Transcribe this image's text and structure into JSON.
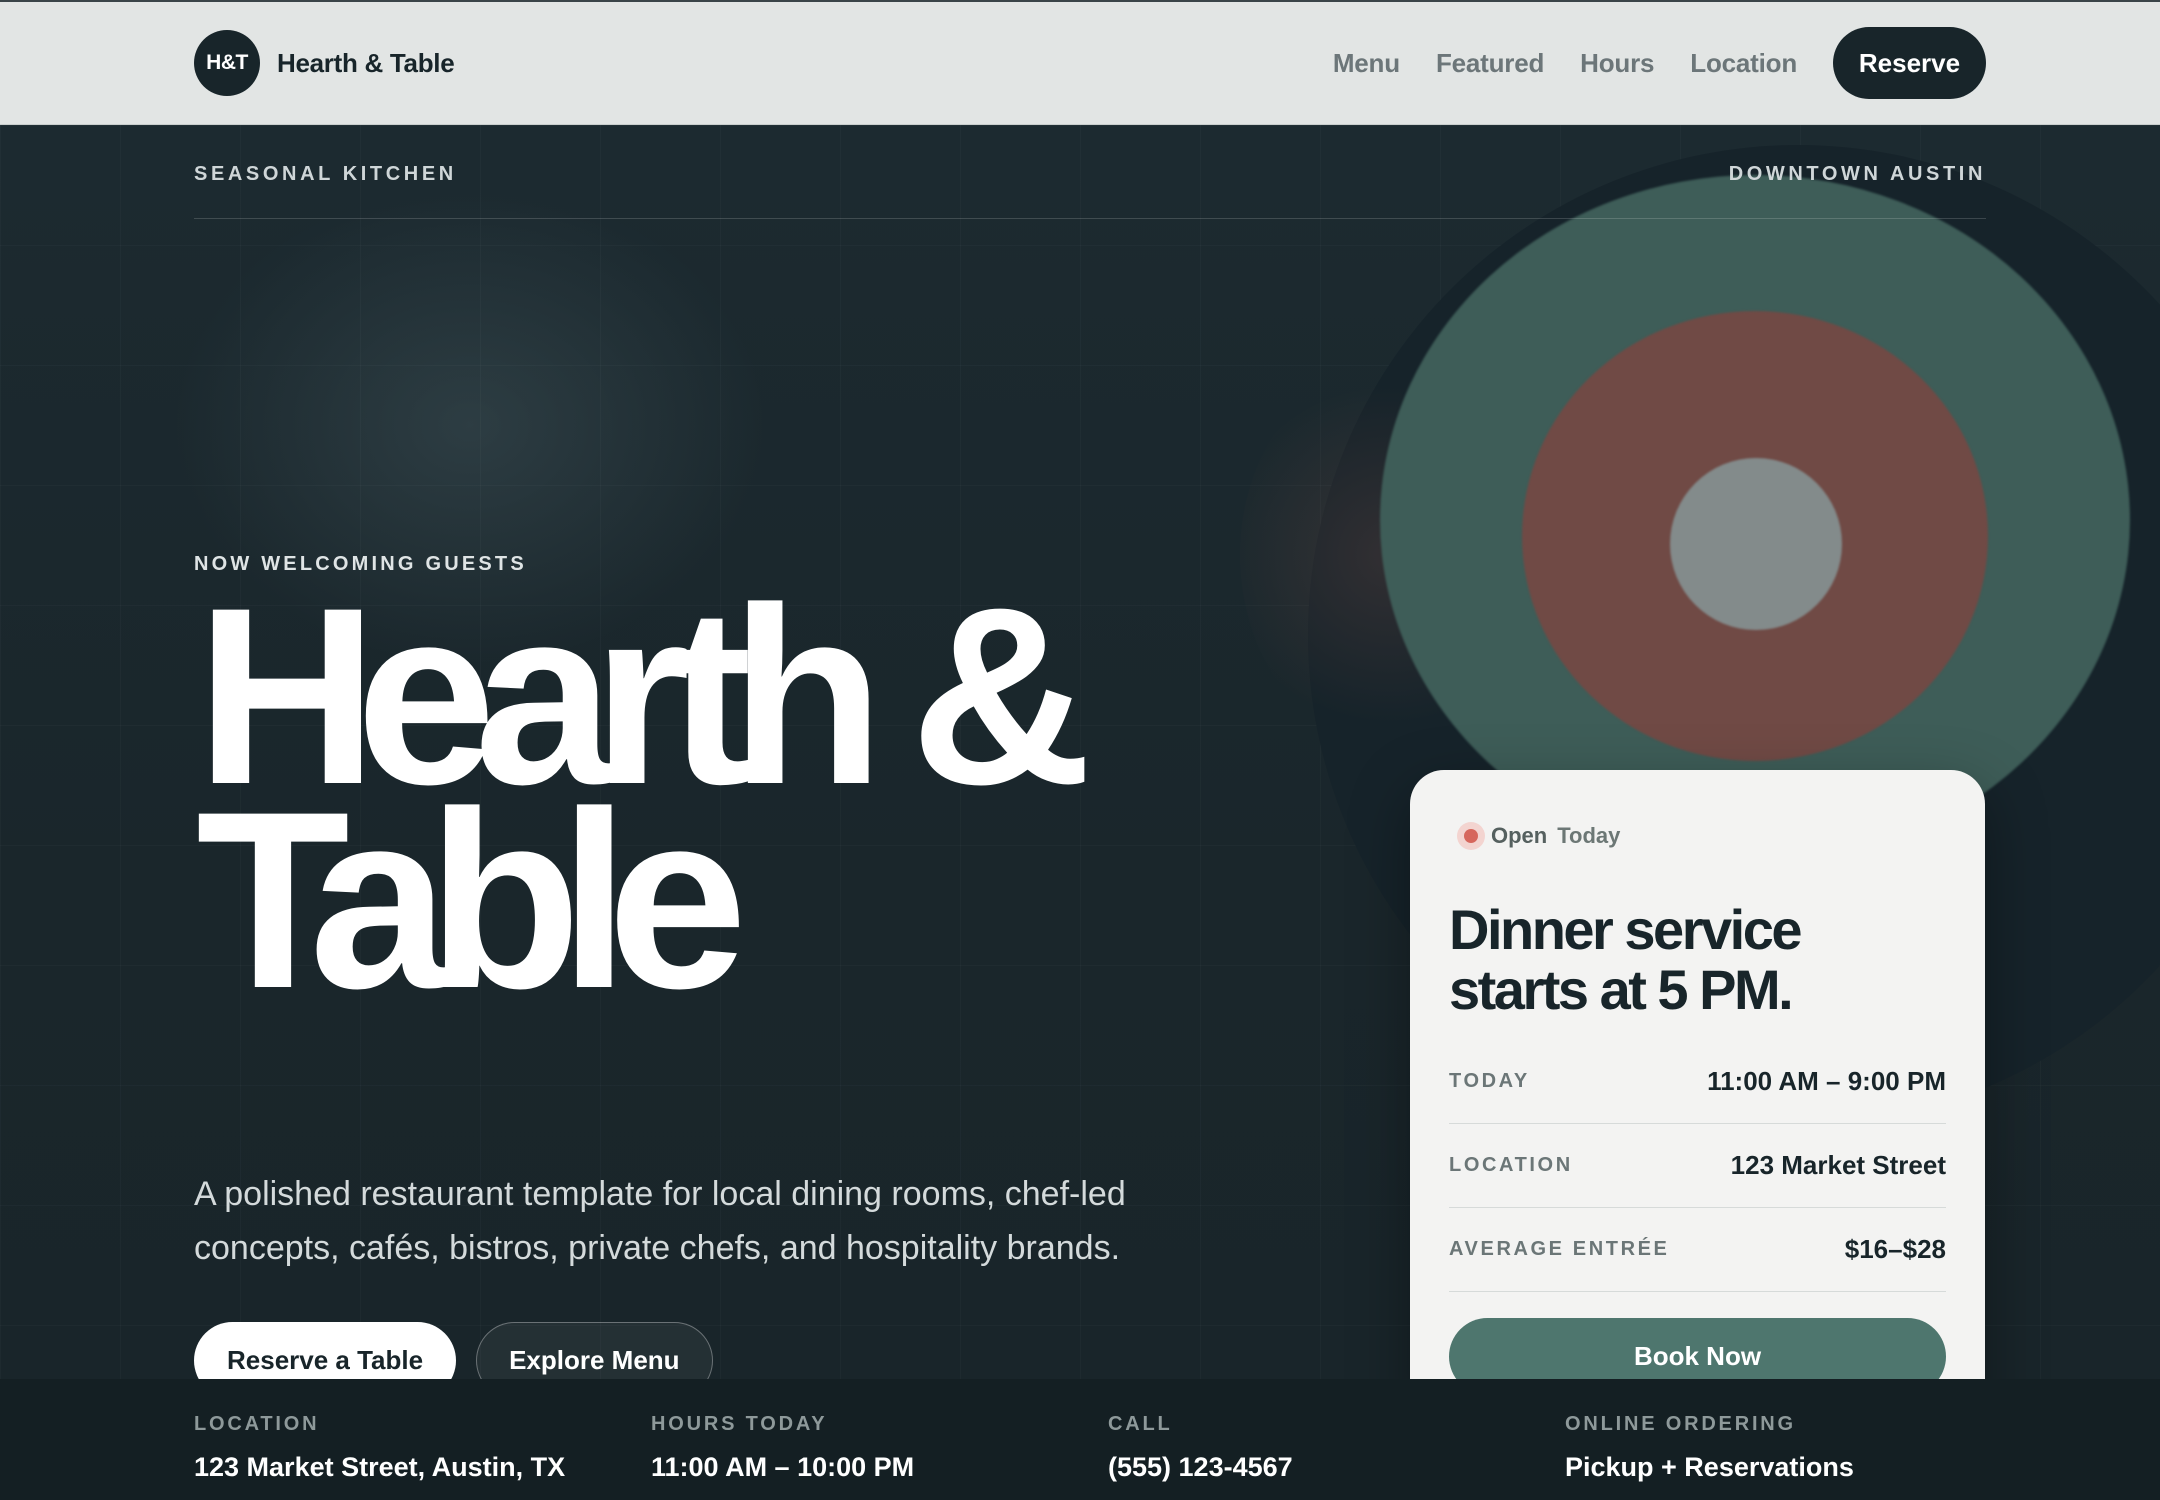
{
  "nav": {
    "logo_mark": "H&T",
    "brand_name": "Hearth & Table",
    "links": [
      "Menu",
      "Featured",
      "Hours",
      "Location"
    ],
    "cta": "Reserve"
  },
  "hero": {
    "eyebrow_left": "SEASONAL KITCHEN",
    "eyebrow_right": "DOWNTOWN AUSTIN",
    "kicker": "NOW WELCOMING GUESTS",
    "title_line1": "Hearth &",
    "title_line2": "Table",
    "copy": "A polished restaurant template for local dining rooms, chef-led concepts, cafés, bistros, private chefs, and hospitality brands.",
    "primary_button": "Reserve a Table",
    "secondary_button": "Explore Menu"
  },
  "card": {
    "status_open": "Open",
    "status_day": "Today",
    "title": "Dinner service starts at 5 PM.",
    "rows": [
      {
        "label": "TODAY",
        "value": "11:00 AM – 9:00 PM"
      },
      {
        "label": "LOCATION",
        "value": "123 Market Street"
      },
      {
        "label": "AVERAGE ENTRÉE",
        "value": "$16–$28"
      }
    ],
    "button": "Book Now"
  },
  "footer": {
    "columns": [
      {
        "label": "LOCATION",
        "value": "123 Market Street, Austin, TX"
      },
      {
        "label": "HOURS TODAY",
        "value": "11:00 AM – 10:00 PM"
      },
      {
        "label": "CALL",
        "value": "(555) 123-4567"
      },
      {
        "label": "ONLINE ORDERING",
        "value": "Pickup + Reservations"
      }
    ]
  },
  "colors": {
    "navy": "#18252a",
    "hero_bg": "#1b272c",
    "accent_green": "#4e766e",
    "status_red": "#d6675d",
    "nav_bg": "#e2e5e4"
  }
}
